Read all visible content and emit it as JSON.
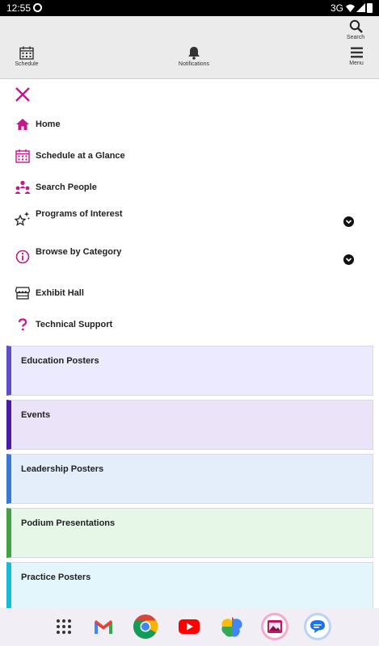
{
  "status_bar": {
    "time": "12:55",
    "network": "3G"
  },
  "top_nav": {
    "search_label": "Search",
    "schedule_label": "Schedule",
    "notifications_label": "Notifications",
    "menu_label": "Menu"
  },
  "menu": {
    "items": [
      {
        "label": "Home",
        "icon": "home-icon"
      },
      {
        "label": "Schedule at a Glance",
        "icon": "calendar-icon"
      },
      {
        "label": "Search People",
        "icon": "people-icon"
      },
      {
        "label": "Programs of Interest",
        "icon": "sparkle-star-icon",
        "expandable": true
      },
      {
        "label": "Browse by Category",
        "icon": "info-icon",
        "expandable": true
      },
      {
        "label": "Exhibit Hall",
        "icon": "storefront-icon"
      },
      {
        "label": "Technical Support",
        "icon": "question-icon"
      }
    ]
  },
  "categories": [
    {
      "label": "Education Posters",
      "bg": "#ebeafe",
      "accent": "#5d4fc7"
    },
    {
      "label": "Events",
      "bg": "#ebe4f8",
      "accent": "#4a1aa8"
    },
    {
      "label": "Leadership Posters",
      "bg": "#e4eefb",
      "accent": "#3a78d4"
    },
    {
      "label": "Podium Presentations",
      "bg": "#e6f6e7",
      "accent": "#43a047"
    },
    {
      "label": "Practice Posters",
      "bg": "#e2f6fb",
      "accent": "#19b8d4"
    }
  ],
  "dock": [
    "app-drawer-icon",
    "gmail-icon",
    "chrome-icon",
    "youtube-icon",
    "photos-icon",
    "gallery-icon",
    "messages-icon"
  ],
  "colors": {
    "accent_magenta": "#c2188b",
    "nav_bg": "#ebebeb"
  }
}
